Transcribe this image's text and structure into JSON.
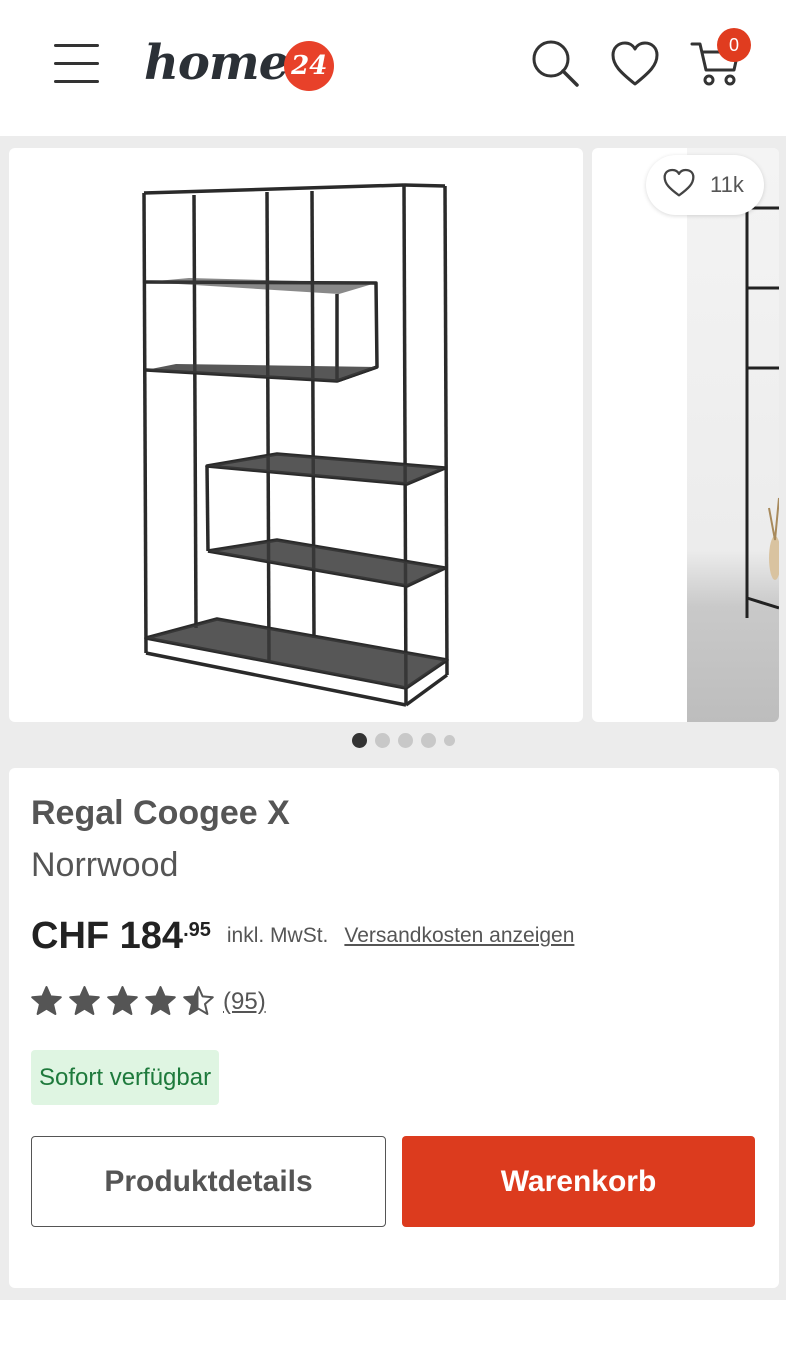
{
  "header": {
    "logo_text": "home",
    "logo_badge": "24",
    "cart_count": "0"
  },
  "gallery": {
    "likes": "11k",
    "dots_count": 5,
    "active_dot": 0
  },
  "product": {
    "title": "Regal Coogee X",
    "brand": "Norrwood",
    "price_main": "CHF 184",
    "price_cents": ".95",
    "tax_note": "inkl. MwSt.",
    "shipping_link": "Versandkosten anzeigen",
    "rating": 4.5,
    "rating_max": 5,
    "review_count": "(95)",
    "availability": "Sofort verfügbar"
  },
  "actions": {
    "details_label": "Produktdetails",
    "cart_label": "Warenkorb"
  },
  "colors": {
    "accent": "#dc3b1e",
    "available_bg": "#dff5e2",
    "available_text": "#1e7a3c"
  },
  "icons": [
    "menu-icon",
    "search-icon",
    "heart-icon",
    "cart-icon",
    "star-icon"
  ]
}
